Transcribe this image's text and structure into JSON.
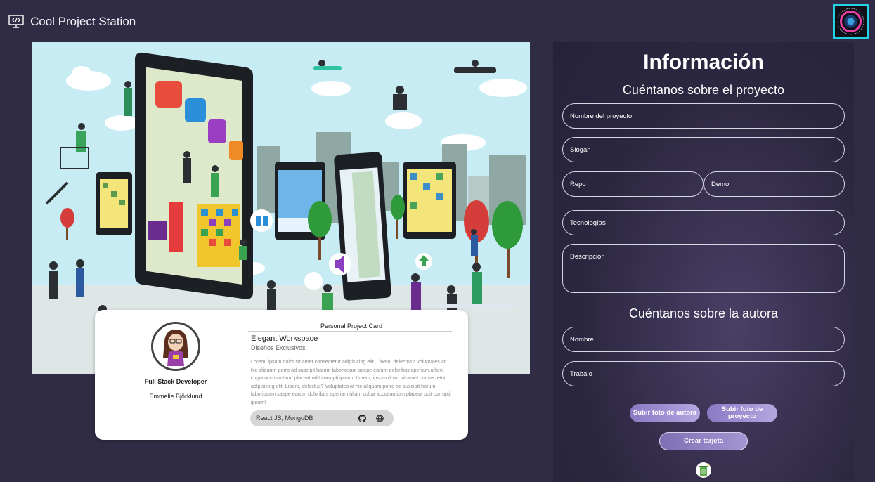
{
  "header": {
    "title": "Cool Project Station",
    "badge_colors": {
      "frame": "#23d2e3",
      "ring": "#e93fa4"
    }
  },
  "card": {
    "label": "Personal Project Card",
    "job": "Full Stack Developer",
    "name": "Emmelie Björklund",
    "project_name": "Elegant Workspace",
    "slogan": "Diseños Exclusivos",
    "description": "Lorem, ipsum dolor sit amet consectetur adipisicing elit. Libero, delectus? Voluptates at hic aliquam porro ad suscipit harum laboriosam saepe earum doloribus aperiam,ullam culpa accusantium placeat odit corrupti ipsum! Lorem, ipsum dolor sit amet consectetur adipisicing elit. Libero, delectus? Voluptates at hic aliquam porro ad suscipit harum laboriosam saepe earum doloribus aperiam,ullam culpa accusantium placeat odit corrupti ipsum!",
    "technologies": "React JS, MongoDB",
    "icons": [
      "github-icon",
      "globe-icon"
    ]
  },
  "form": {
    "title": "Información",
    "project_section": "Cuéntanos sobre el proyecto",
    "author_section": "Cuéntanos sobre la autora",
    "fields": {
      "project_name": "Nombre del proyecto",
      "slogan": "Slogan",
      "repo": "Repo",
      "demo": "Demo",
      "technologies": "Tecnologías",
      "description": "Descripción",
      "author_name": "Nombre",
      "job": "Trabajo"
    },
    "buttons": {
      "upload_author": "Subir foto de autora",
      "upload_project": "Subir foto de proyecto",
      "create": "Crear tarjeta"
    },
    "accent_color": "#8a79c4"
  }
}
